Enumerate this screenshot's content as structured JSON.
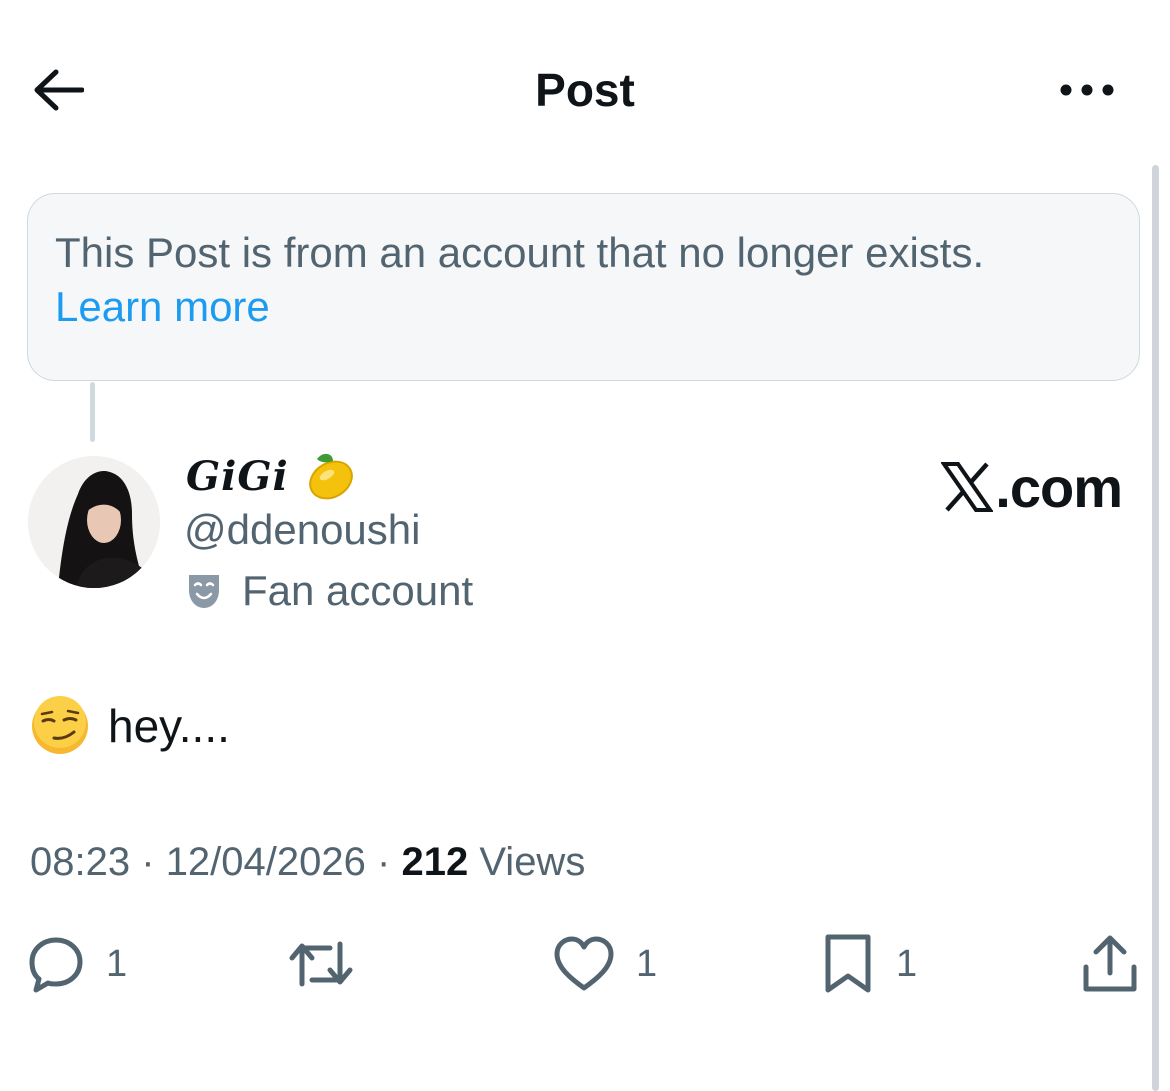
{
  "header": {
    "title": "Post",
    "back_icon": "arrow-left-icon",
    "more_icon": "more-horizontal-icon"
  },
  "notice": {
    "text": "This Post is from an account that no longer exists.",
    "link": "Learn more",
    "link_color": "#1d9bf0"
  },
  "author": {
    "name": "GiGi",
    "name_emoji": "🍋",
    "handle": "@ddenoushi",
    "label": "Fan account",
    "label_icon": "theater-mask-icon"
  },
  "watermark": {
    "text": ".com",
    "logo": "x-logo-icon"
  },
  "post": {
    "emoji": "😏",
    "text": "hey...."
  },
  "meta": {
    "time": "08:23",
    "separator": "·",
    "date": "12/04/2026",
    "views_count": "212",
    "views_label": "Views"
  },
  "actions": {
    "reply": {
      "icon": "reply-icon",
      "count": "1"
    },
    "repost": {
      "icon": "repost-icon",
      "count": ""
    },
    "like": {
      "icon": "heart-icon",
      "count": "1"
    },
    "bookmark": {
      "icon": "bookmark-icon",
      "count": "1"
    },
    "share": {
      "icon": "share-icon"
    }
  },
  "colors": {
    "text_primary": "#0f1419",
    "text_secondary": "#536471",
    "accent": "#1d9bf0",
    "border": "#cfd9de"
  }
}
